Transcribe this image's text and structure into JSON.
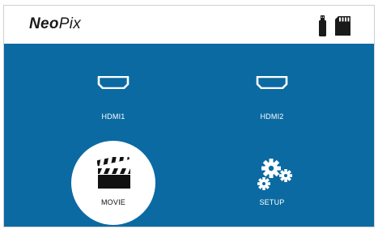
{
  "app": {
    "brand_bold": "Neo",
    "brand_regular": "Pix"
  },
  "header": {
    "status_icons": [
      "usb-drive-icon",
      "sd-card-icon"
    ]
  },
  "menu": {
    "items": [
      {
        "label": "HDMI1",
        "icon": "hdmi-port-icon",
        "selected": false
      },
      {
        "label": "HDMI2",
        "icon": "hdmi-port-icon",
        "selected": false
      },
      {
        "label": "MOVIE",
        "icon": "clapperboard-icon",
        "selected": true
      },
      {
        "label": "SETUP",
        "icon": "gears-icon",
        "selected": false
      }
    ]
  },
  "colors": {
    "background": "#0b6aa2",
    "selection": "#ffffff",
    "text": "#ffffff"
  }
}
